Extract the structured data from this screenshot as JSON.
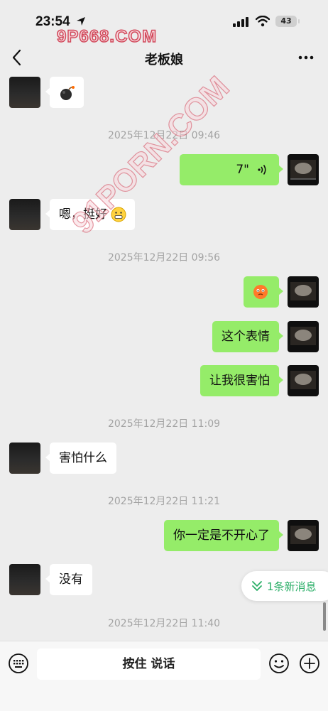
{
  "status_bar": {
    "time": "23:54",
    "battery": "43"
  },
  "watermarks": {
    "top": "9P668.COM",
    "diagonal": "91PORN.COM"
  },
  "nav": {
    "title": "老板娘"
  },
  "messages": [
    {
      "type": "emoji",
      "side": "left",
      "icon": "bomb-emoji"
    },
    {
      "type": "timestamp",
      "text": "2025年12月22日 09:46"
    },
    {
      "type": "voice",
      "side": "right",
      "duration": "7\""
    },
    {
      "type": "text",
      "side": "left",
      "text": "嗯，挺好",
      "icon": "grimace-emoji"
    },
    {
      "type": "timestamp",
      "text": "2025年12月22日 09:56"
    },
    {
      "type": "emoji",
      "side": "right",
      "icon": "scared-face-emoji"
    },
    {
      "type": "text",
      "side": "right",
      "text": "这个表情"
    },
    {
      "type": "text",
      "side": "right",
      "text": "让我很害怕"
    },
    {
      "type": "timestamp",
      "text": "2025年12月22日 11:09"
    },
    {
      "type": "text",
      "side": "left",
      "text": "害怕什么"
    },
    {
      "type": "timestamp",
      "text": "2025年12月22日 11:21"
    },
    {
      "type": "text",
      "side": "right",
      "text": "你一定是不开心了"
    },
    {
      "type": "text",
      "side": "left",
      "text": "没有"
    },
    {
      "type": "timestamp",
      "text": "2025年12月22日 11:40"
    }
  ],
  "new_messages_pill": "1条新消息",
  "input": {
    "voice_label": "按住 说话"
  },
  "colors": {
    "sent_bubble": "#95ec69",
    "received_bubble": "#ffffff",
    "background": "#ededed",
    "accent": "#2aae67"
  }
}
